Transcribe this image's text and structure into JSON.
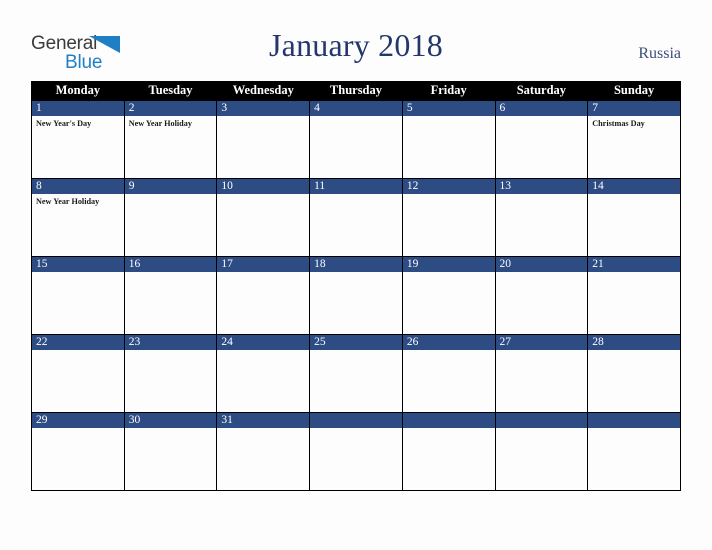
{
  "brand": {
    "name_part1": "General",
    "name_part2": "Blue",
    "triangle_icon": "blue-triangle-icon",
    "accent_color": "#1f7fc4",
    "text_color": "#3b3b3b"
  },
  "header": {
    "title": "January 2018",
    "country": "Russia",
    "title_color": "#22386b"
  },
  "calendar": {
    "month": "January",
    "year": "2018",
    "week_start": "Monday",
    "weekday_headers": [
      "Monday",
      "Tuesday",
      "Wednesday",
      "Thursday",
      "Friday",
      "Saturday",
      "Sunday"
    ],
    "colors": {
      "header_bg": "#000000",
      "header_text": "#ffffff",
      "day_bar_bg": "#2e4c84",
      "day_bar_text": "#ffffff",
      "cell_bg": "#fdfdfd",
      "grid_line": "#000000",
      "page_bg": "#fdfdfd"
    },
    "weeks": [
      {
        "days": [
          {
            "number": "1",
            "events": [
              "New Year's Day"
            ]
          },
          {
            "number": "2",
            "events": [
              "New Year Holiday"
            ]
          },
          {
            "number": "3",
            "events": []
          },
          {
            "number": "4",
            "events": []
          },
          {
            "number": "5",
            "events": []
          },
          {
            "number": "6",
            "events": []
          },
          {
            "number": "7",
            "events": [
              "Christmas Day"
            ]
          }
        ]
      },
      {
        "days": [
          {
            "number": "8",
            "events": [
              "New Year Holiday"
            ]
          },
          {
            "number": "9",
            "events": []
          },
          {
            "number": "10",
            "events": []
          },
          {
            "number": "11",
            "events": []
          },
          {
            "number": "12",
            "events": []
          },
          {
            "number": "13",
            "events": []
          },
          {
            "number": "14",
            "events": []
          }
        ]
      },
      {
        "days": [
          {
            "number": "15",
            "events": []
          },
          {
            "number": "16",
            "events": []
          },
          {
            "number": "17",
            "events": []
          },
          {
            "number": "18",
            "events": []
          },
          {
            "number": "19",
            "events": []
          },
          {
            "number": "20",
            "events": []
          },
          {
            "number": "21",
            "events": []
          }
        ]
      },
      {
        "days": [
          {
            "number": "22",
            "events": []
          },
          {
            "number": "23",
            "events": []
          },
          {
            "number": "24",
            "events": []
          },
          {
            "number": "25",
            "events": []
          },
          {
            "number": "26",
            "events": []
          },
          {
            "number": "27",
            "events": []
          },
          {
            "number": "28",
            "events": []
          }
        ]
      },
      {
        "days": [
          {
            "number": "29",
            "events": []
          },
          {
            "number": "30",
            "events": []
          },
          {
            "number": "31",
            "events": []
          },
          {
            "number": "",
            "events": []
          },
          {
            "number": "",
            "events": []
          },
          {
            "number": "",
            "events": []
          },
          {
            "number": "",
            "events": []
          }
        ]
      }
    ]
  }
}
